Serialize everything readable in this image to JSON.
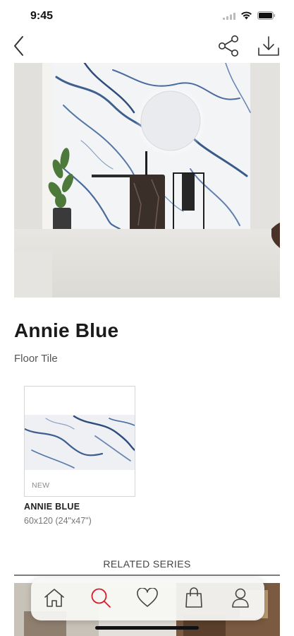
{
  "status_bar": {
    "time": "9:45",
    "icons": [
      "signal-icon",
      "wifi-icon",
      "battery-icon"
    ]
  },
  "nav": {
    "icons": [
      "back-chevron-icon",
      "share-icon",
      "download-icon"
    ]
  },
  "product": {
    "name": "Annie Blue",
    "category": "Floor Tile"
  },
  "variants": [
    {
      "badge": "NEW",
      "name": "ANNIE BLUE",
      "size": "60x120 (24\"x47\")"
    }
  ],
  "related": {
    "title": "RELATED SERIES"
  },
  "tab_bar": {
    "tabs": [
      {
        "icon": "home-icon"
      },
      {
        "icon": "search-icon",
        "active": true
      },
      {
        "icon": "heart-icon"
      },
      {
        "icon": "shopping-bag-icon"
      },
      {
        "icon": "profile-icon"
      }
    ]
  },
  "colors": {
    "accent": "#d0202a",
    "text": "#1a1a1a",
    "muted": "#777777",
    "tab_icon": "#444444"
  }
}
